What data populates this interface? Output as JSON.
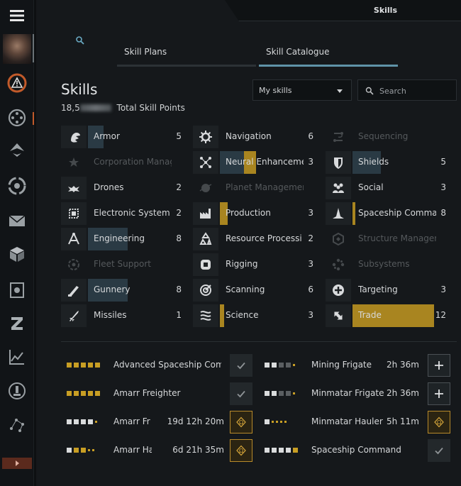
{
  "window": {
    "title": "Skills"
  },
  "tabs": [
    {
      "label": "Skill Plans",
      "active": false
    },
    {
      "label": "Skill Catalogue",
      "active": true
    }
  ],
  "header": {
    "title": "Skills",
    "sp_visible": "18,5",
    "sp_label": "Total Skill Points"
  },
  "filter": {
    "selected": "My skills"
  },
  "search": {
    "placeholder": "Search"
  },
  "categories": [
    {
      "label": "Armor",
      "count": "5",
      "icon": "armor-icon",
      "enabled": true,
      "level": 0.2,
      "trained": 0
    },
    {
      "label": "Corporation Manag",
      "count": "",
      "icon": "corporation-management-icon",
      "enabled": false,
      "level": 0,
      "trained": 0
    },
    {
      "label": "Drones",
      "count": "2",
      "icon": "drones-icon",
      "enabled": true,
      "level": 0.0,
      "trained": 0
    },
    {
      "label": "Electronic System",
      "count": "2",
      "icon": "electronic-systems-icon",
      "enabled": true,
      "level": 0.0,
      "trained": 0
    },
    {
      "label": "Engineering",
      "count": "8",
      "icon": "engineering-icon",
      "enabled": true,
      "level": 0.5,
      "trained": 0
    },
    {
      "label": "Fleet Support",
      "count": "",
      "icon": "fleet-support-icon",
      "enabled": false,
      "level": 0,
      "trained": 0
    },
    {
      "label": "Gunnery",
      "count": "8",
      "icon": "gunnery-icon",
      "enabled": true,
      "level": 0.5,
      "trained": 0
    },
    {
      "label": "Missiles",
      "count": "1",
      "icon": "missiles-icon",
      "enabled": true,
      "level": 0.0,
      "trained": 0
    },
    {
      "label": "Navigation",
      "count": "6",
      "icon": "navigation-icon",
      "enabled": true,
      "level": 0.0,
      "trained": 0
    },
    {
      "label": "Neural Enhanceme",
      "count": "3",
      "icon": "neural-enhancement-icon",
      "enabled": true,
      "level": 0.3,
      "trained": 0.12
    },
    {
      "label": "Planet Managemer",
      "count": "",
      "icon": "planet-management-icon",
      "enabled": false,
      "level": 0,
      "trained": 0
    },
    {
      "label": "Production",
      "count": "3",
      "icon": "production-icon",
      "enabled": true,
      "level": 0.0,
      "trained": 0.08
    },
    {
      "label": "Resource Processi",
      "count": "2",
      "icon": "resource-processing-icon",
      "enabled": true,
      "level": 0.0,
      "trained": 0
    },
    {
      "label": "Rigging",
      "count": "3",
      "icon": "rigging-icon",
      "enabled": true,
      "level": 0.0,
      "trained": 0
    },
    {
      "label": "Scanning",
      "count": "6",
      "icon": "scanning-icon",
      "enabled": true,
      "level": 0.0,
      "trained": 0
    },
    {
      "label": "Science",
      "count": "3",
      "icon": "science-icon",
      "enabled": true,
      "level": 0.0,
      "trained": 0.04
    },
    {
      "label": "Sequencing",
      "count": "",
      "icon": "sequencing-icon",
      "enabled": false,
      "level": 0,
      "trained": 0
    },
    {
      "label": "Shields",
      "count": "5",
      "icon": "shields-icon",
      "enabled": true,
      "level": 0.36,
      "trained": 0
    },
    {
      "label": "Social",
      "count": "3",
      "icon": "social-icon",
      "enabled": true,
      "level": 0.0,
      "trained": 0
    },
    {
      "label": "Spaceship Command",
      "count": "8",
      "icon": "spaceship-command-icon",
      "enabled": true,
      "level": 0.0,
      "trained": 0.03
    },
    {
      "label": "Structure Managem",
      "count": "",
      "icon": "structure-management-icon",
      "enabled": false,
      "level": 0,
      "trained": 0
    },
    {
      "label": "Subsystems",
      "count": "",
      "icon": "subsystems-icon",
      "enabled": false,
      "level": 0,
      "trained": 0
    },
    {
      "label": "Targeting",
      "count": "3",
      "icon": "targeting-icon",
      "enabled": true,
      "level": 0.0,
      "trained": 0
    },
    {
      "label": "Trade",
      "count": "12",
      "icon": "trade-icon",
      "enabled": true,
      "level": 0.0,
      "trained": 0.82
    }
  ],
  "queue": [
    {
      "name": "Advanced Spaceship Com",
      "time": "",
      "pips": "ggggg",
      "action": "check"
    },
    {
      "name": "Amarr Freighter",
      "time": "",
      "pips": "ggggg",
      "action": "check"
    },
    {
      "name": "Amarr Fr",
      "time": "19d 12h 20m",
      "pips": "wwwwd",
      "action": "omega"
    },
    {
      "name": "Amarr Hau",
      "time": "6d 21h 35m",
      "pips": "wggdd",
      "action": "omega"
    },
    {
      "name": "Mining Frigate",
      "time": "2h 36m",
      "pips": "wwkkd",
      "action": "plus"
    },
    {
      "name": "Minmatar Frigate",
      "time": "2h 36m",
      "pips": "wwkkd",
      "action": "plus"
    },
    {
      "name": "Minmatar Hauler",
      "time": "5h 11m",
      "pips": "wdddd",
      "action": "omega"
    },
    {
      "name": "Spaceship Command",
      "time": "",
      "pips": "wwwwg",
      "action": "check"
    }
  ],
  "colors": {
    "accent": "#5f93a8",
    "gold": "#c89e24",
    "alert": "#c15a2a"
  }
}
